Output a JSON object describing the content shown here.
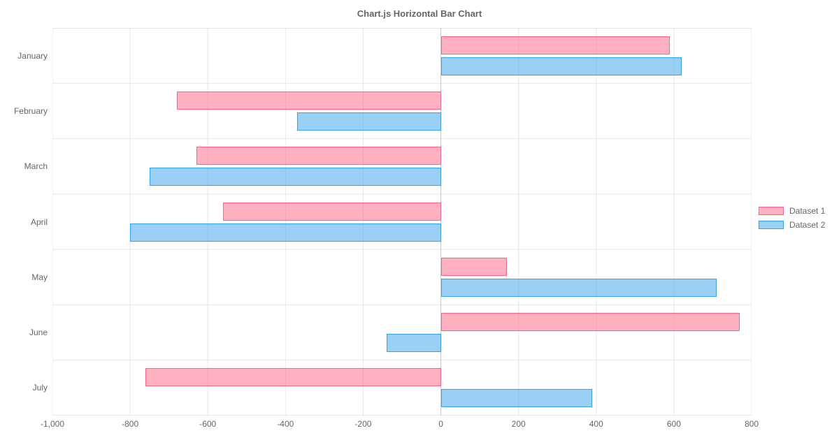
{
  "chart_data": {
    "type": "bar",
    "orientation": "horizontal",
    "title": "Chart.js Horizontal Bar Chart",
    "categories": [
      "January",
      "February",
      "March",
      "April",
      "May",
      "June",
      "July"
    ],
    "series": [
      {
        "name": "Dataset 1",
        "values": [
          590,
          -680,
          -630,
          -560,
          170,
          770,
          -760
        ],
        "fill": "rgba(255,99,132,0.5)",
        "border": "rgb(255,99,132)"
      },
      {
        "name": "Dataset 2",
        "values": [
          620,
          -370,
          -750,
          -800,
          710,
          -140,
          390
        ],
        "fill": "rgba(54,162,235,0.5)",
        "border": "rgb(54,162,235)"
      }
    ],
    "x_ticks": [
      -1000,
      -800,
      -600,
      -400,
      -200,
      0,
      200,
      400,
      600,
      800
    ],
    "x_tick_labels": [
      "-1,000",
      "-800",
      "-600",
      "-400",
      "-200",
      "0",
      "200",
      "400",
      "600",
      "800"
    ],
    "xlim": [
      -1000,
      800
    ],
    "grid": true,
    "legend_position": "right"
  }
}
